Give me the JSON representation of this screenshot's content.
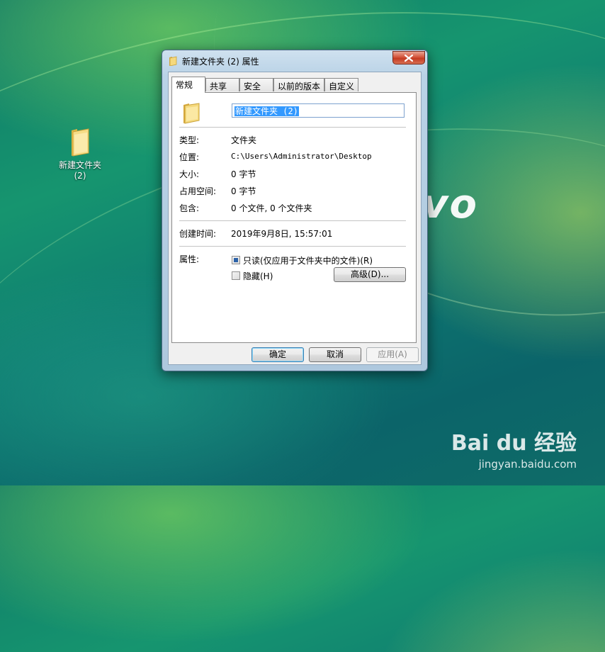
{
  "desktop": {
    "icon_label_line1": "新建文件夹",
    "icon_label_line2": "(2)",
    "wallpaper_logo_text": "vo"
  },
  "watermark": {
    "main": "Bai du 经验",
    "sub": "jingyan.baidu.com"
  },
  "dialog": {
    "title": "新建文件夹 (2) 属性",
    "tabs": [
      "常规",
      "共享",
      "安全",
      "以前的版本",
      "自定义"
    ],
    "active_tab": "常规",
    "name_value": "新建文件夹 (2)",
    "rows": {
      "type_label": "类型:",
      "type_value": "文件夹",
      "location_label": "位置:",
      "location_value": "C:\\Users\\Administrator\\Desktop",
      "size_label": "大小:",
      "size_value": "0 字节",
      "disk_label": "占用空间:",
      "disk_value": "0 字节",
      "contains_label": "包含:",
      "contains_value": "0 个文件, 0 个文件夹",
      "created_label": "创建时间:",
      "created_value": "2019年9月8日, 15:57:01"
    },
    "attributes": {
      "label": "属性:",
      "readonly_label": "只读(仅应用于文件夹中的文件)(R)",
      "readonly_state": "indeterminate",
      "hidden_label": "隐藏(H)",
      "hidden_state": "unchecked",
      "advanced_button": "高级(D)..."
    },
    "buttons": {
      "ok": "确定",
      "cancel": "取消",
      "apply": "应用(A)"
    }
  }
}
